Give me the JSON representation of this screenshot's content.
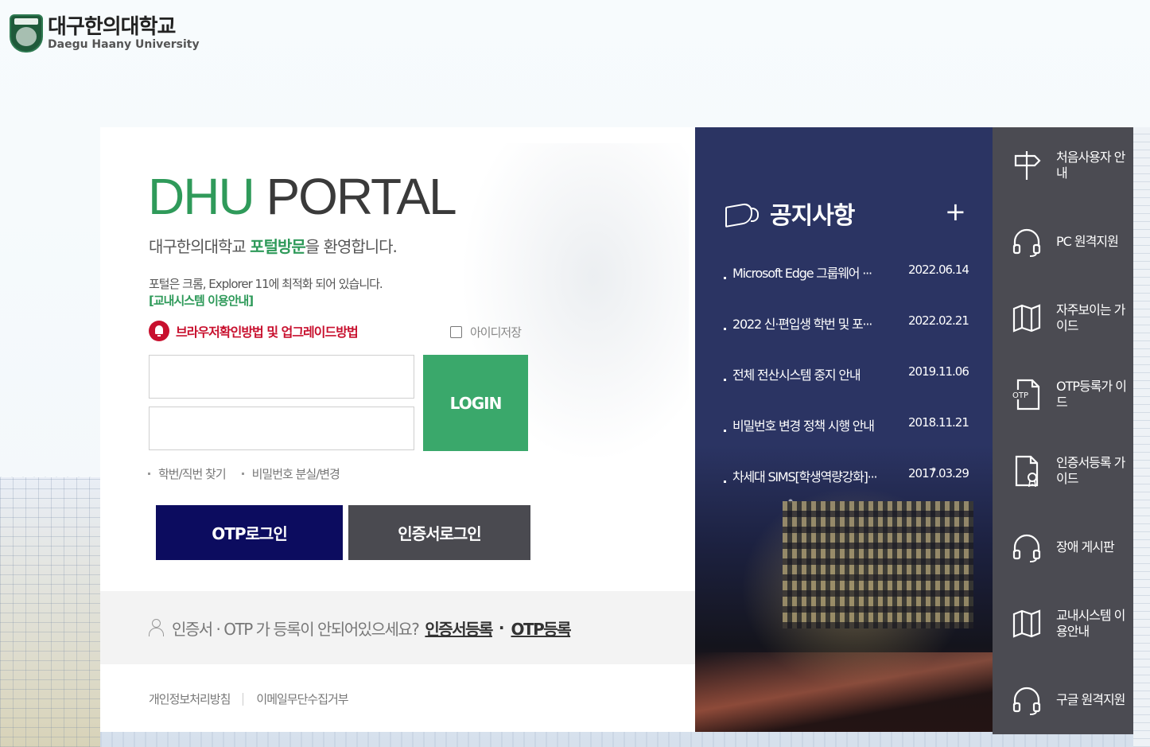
{
  "logo": {
    "name_kr": "대구한의대학교",
    "name_en": "Daegu Haany University"
  },
  "login": {
    "portal_title_part1": "DHU",
    "portal_title_part2": " PORTAL",
    "welcome_pre": "대구한의대학교 ",
    "welcome_highlight": "포털방문",
    "welcome_post": "을 환영합니다.",
    "optimized_text": "포털은 크롬, Explorer 11에 최적화 되어 있습니다.",
    "intra_link": "[교내시스템 이용안내]",
    "browser_link": "브라우저확인방법 및 업그레이드방법",
    "save_id_label": "아이디저장",
    "id_value": "",
    "pw_value": "",
    "login_button": "LOGIN",
    "find_id": "학번/직번 찾기",
    "find_pw": "비밀번호 분실/변경",
    "otp_login": "OTP로그인",
    "cert_login": "인증서로그인"
  },
  "registration": {
    "text": "인증서 · OTP 가 등록이 안되어있으세요?",
    "cert_link": "인증서등록",
    "separator": "·",
    "otp_link": "OTP등록"
  },
  "footer": {
    "privacy": "개인정보처리방침",
    "email_refusal": "이메일무단수집거부"
  },
  "notice": {
    "title": "공지사항",
    "more": "+",
    "items": [
      {
        "subject": "Microsoft Edge 그룹웨어 ···",
        "date": "2022.06.14"
      },
      {
        "subject": "2022 신·편입생 학번 및 포···",
        "date": "2022.02.21"
      },
      {
        "subject": "전체 전산시스템 중지 안내",
        "date": "2019.11.06"
      },
      {
        "subject": "비밀번호 변경 정책 시행 안내",
        "date": "2018.11.21"
      },
      {
        "subject": "차세대 SIMS[학생역량강화]···",
        "date": "2017.03.29"
      }
    ]
  },
  "quick_menu": {
    "items": [
      {
        "label": "처음사용자 안내",
        "icon": "signpost-icon"
      },
      {
        "label": "PC 원격지원",
        "icon": "headset-icon"
      },
      {
        "label": "자주보이는 가이드",
        "icon": "map-icon"
      },
      {
        "label": "OTP등록가 이드",
        "icon": "otp-document-icon"
      },
      {
        "label": "인증서등록 가이드",
        "icon": "certificate-document-icon"
      },
      {
        "label": "장애 게시판",
        "icon": "headset-icon"
      },
      {
        "label": "교내시스템 이용안내",
        "icon": "map-icon"
      },
      {
        "label": "구글 원격지원",
        "icon": "headset-icon"
      }
    ]
  },
  "colors": {
    "brand_green": "#3aa86b",
    "otp_navy": "#0c0c5f",
    "cert_gray": "#4a4a50",
    "notice_bg": "#2b3463",
    "quick_bg": "#4b4b52",
    "alert_red": "#c8102e"
  }
}
